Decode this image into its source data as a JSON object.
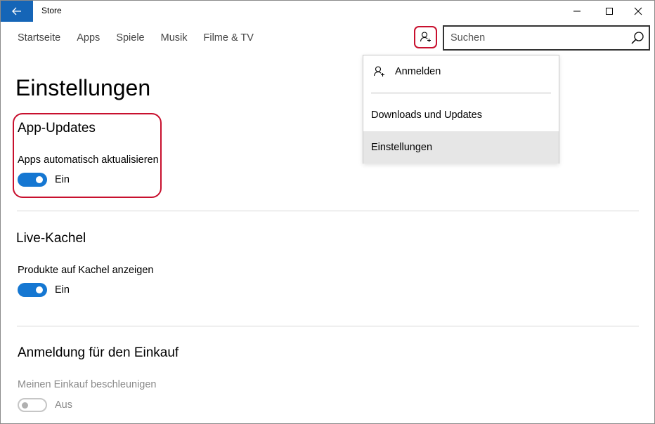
{
  "window": {
    "title": "Store",
    "controls": [
      "minimize",
      "maximize",
      "close"
    ]
  },
  "nav": {
    "items": [
      "Startseite",
      "Apps",
      "Spiele",
      "Musik",
      "Filme & TV"
    ]
  },
  "search": {
    "placeholder": "Suchen"
  },
  "account_menu": {
    "items": [
      {
        "label": "Anmelden",
        "icon": "person-add-icon"
      },
      {
        "label": "Downloads und Updates"
      },
      {
        "label": "Einstellungen",
        "selected": true
      }
    ]
  },
  "page": {
    "title": "Einstellungen",
    "sections": [
      {
        "heading": "App-Updates",
        "setting": "Apps automatisch aktualisieren",
        "state": "Ein",
        "enabled": true,
        "on": true
      },
      {
        "heading": "Live-Kachel",
        "setting": "Produkte auf Kachel anzeigen",
        "state": "Ein",
        "enabled": true,
        "on": true
      },
      {
        "heading": "Anmeldung für den Einkauf",
        "setting": "Meinen Einkauf beschleunigen",
        "state": "Aus",
        "enabled": false,
        "on": false
      }
    ]
  },
  "colors": {
    "accent": "#1565b7",
    "toggle_on": "#1577d2",
    "highlight": "#c8102e",
    "menu_selected_bg": "#e6e6e6"
  }
}
